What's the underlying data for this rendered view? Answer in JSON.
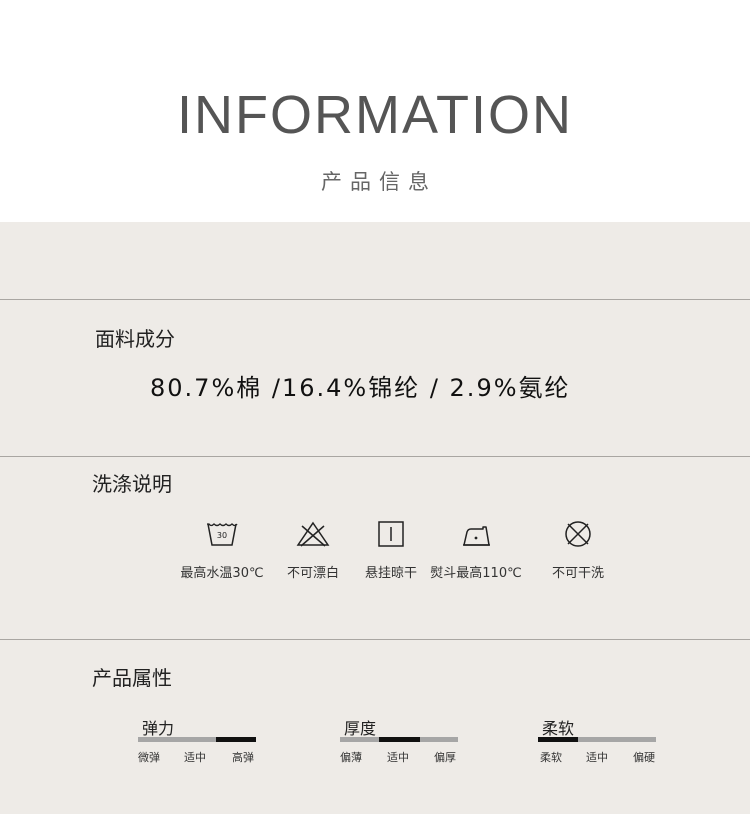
{
  "header": {
    "title": "INFORMATION",
    "subtitle": "产品信息"
  },
  "fabric": {
    "title": "面料成分",
    "composition": "80.7%棉 /16.4%锦纶 / 2.9%氨纶"
  },
  "care": {
    "title": "洗涤说明",
    "items": [
      {
        "icon": "wash-30-icon",
        "label": "最高水温30℃",
        "temp": "30"
      },
      {
        "icon": "no-bleach-icon",
        "label": "不可漂白"
      },
      {
        "icon": "line-dry-shade-icon",
        "label": "悬挂晾干"
      },
      {
        "icon": "iron-icon",
        "label": "熨斗最高110℃"
      },
      {
        "icon": "no-dry-clean-icon",
        "label": "不可干洗"
      }
    ]
  },
  "attributes": {
    "title": "产品属性",
    "items": [
      {
        "name": "弹力",
        "labels": [
          "微弹",
          "适中",
          "高弹"
        ],
        "selected_index": 2
      },
      {
        "name": "厚度",
        "labels": [
          "偏薄",
          "适中",
          "偏厚"
        ],
        "selected_index": 1
      },
      {
        "name": "柔软",
        "labels": [
          "柔软",
          "适中",
          "偏硬"
        ],
        "selected_index": 0
      }
    ]
  }
}
